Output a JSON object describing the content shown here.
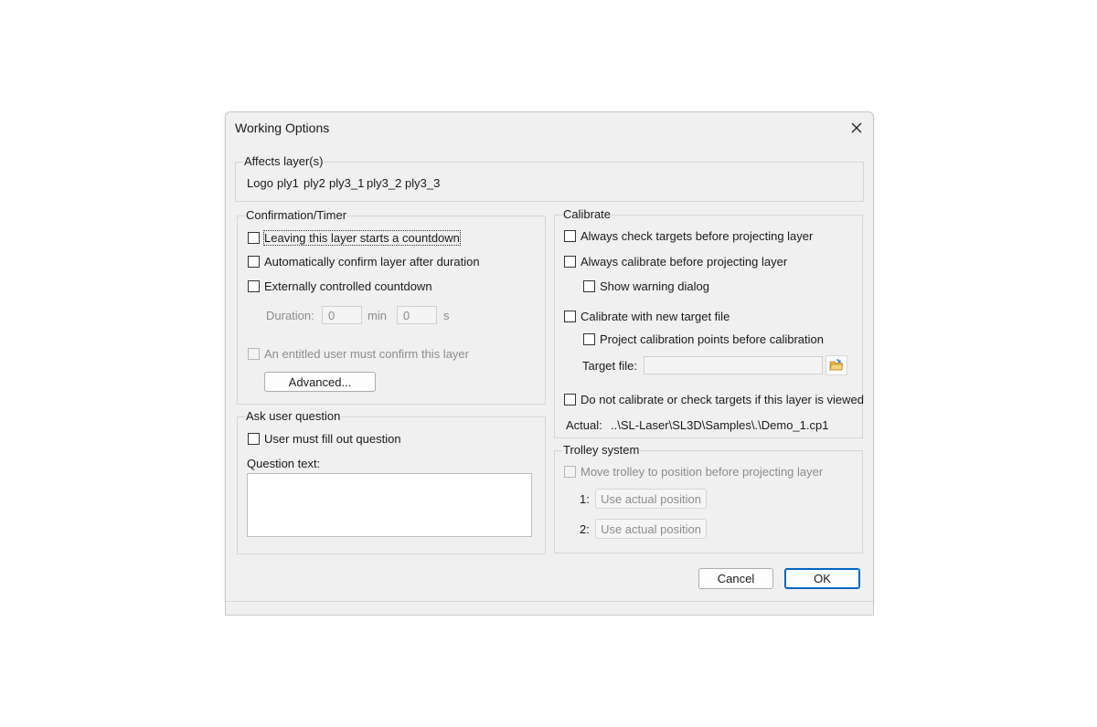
{
  "window": {
    "title": "Working Options"
  },
  "affects": {
    "legend": "Affects layer(s)",
    "layers": [
      "Logo",
      "ply1",
      "ply2",
      "ply3_1",
      "ply3_2",
      "ply3_3"
    ]
  },
  "confirmation": {
    "legend": "Confirmation/Timer",
    "leaving_countdown": "Leaving this layer starts a countdown",
    "auto_confirm": "Automatically confirm layer after duration",
    "external_countdown": "Externally controlled countdown",
    "duration_label": "Duration:",
    "duration_min_value": "0",
    "min_label": "min",
    "duration_sec_value": "0",
    "sec_label": "s",
    "entitled_user": "An entitled user must confirm this layer",
    "advanced_button": "Advanced..."
  },
  "question": {
    "legend": "Ask user question",
    "must_fill": "User must fill out question",
    "text_label": "Question text:",
    "text_value": ""
  },
  "calibrate": {
    "legend": "Calibrate",
    "check_targets": "Always check targets before projecting layer",
    "always_calibrate": "Always calibrate before projecting layer",
    "show_warning": "Show warning dialog",
    "new_target_file": "Calibrate with new target file",
    "project_points": "Project calibration points before calibration",
    "target_file_label": "Target file:",
    "target_file_value": "",
    "do_not_calibrate": "Do not calibrate or check targets if this layer is viewed",
    "actual_label": "Actual:",
    "actual_value": "..\\SL-Laser\\SL3D\\Samples\\.\\Demo_1.cp1"
  },
  "trolley": {
    "legend": "Trolley system",
    "move_trolley": "Move trolley to position before projecting layer",
    "pos1_label": "1:",
    "pos1_button": "Use actual position",
    "pos2_label": "2:",
    "pos2_button": "Use actual position"
  },
  "footer": {
    "cancel": "Cancel",
    "ok": "OK"
  },
  "colors": {
    "dialog_bg": "#f0f0f0",
    "accent": "#0067c0"
  }
}
